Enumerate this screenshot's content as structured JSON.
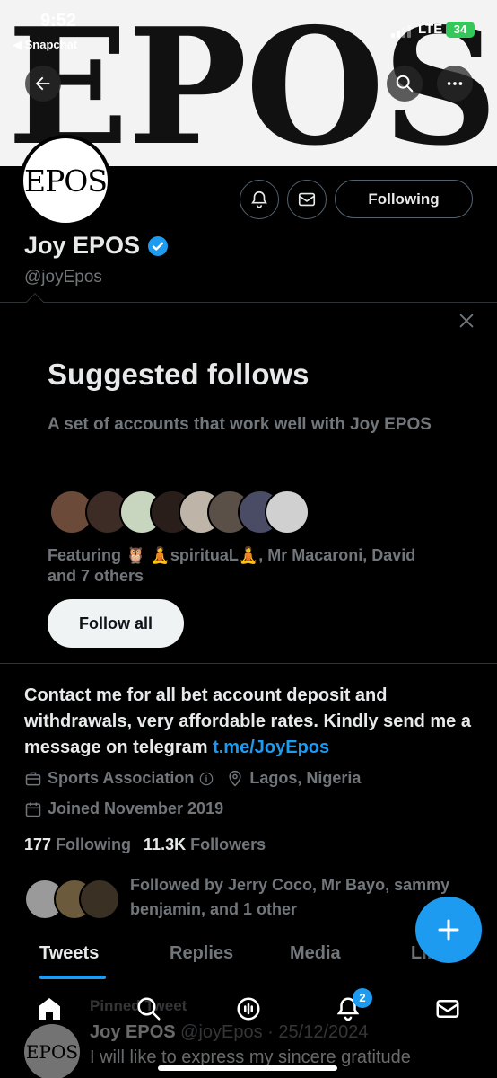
{
  "status_bar": {
    "time": "9:52",
    "back_app": "◀ Snapchat",
    "network": "LTE",
    "battery": "34"
  },
  "banner": {
    "text": "EPOS"
  },
  "profile": {
    "avatar_text": "EPOS",
    "display_name": "Joy EPOS",
    "handle": "@joyEpos",
    "following_button": "Following"
  },
  "suggested": {
    "title": "Suggested follows",
    "subtitle": "A set of accounts that work well with Joy EPOS",
    "featuring": "Featuring 🦉 🧘spirituaL🧘, Mr Macaroni, David and 7 others",
    "follow_all": "Follow all"
  },
  "bio": {
    "text": "Contact me for all bet account deposit and withdrawals, very affordable rates. Kindly send me a message on telegram ",
    "link": "t.me/JoyEpos"
  },
  "meta": {
    "category": "Sports Association",
    "location": "Lagos, Nigeria",
    "joined": "Joined November 2019"
  },
  "counts": {
    "following_count": "177",
    "following_label": "Following",
    "followers_count": "11.3K",
    "followers_label": "Followers"
  },
  "followed_by": "Followed by Jerry Coco, Mr Bayo, sammy benjamin, and 1 other",
  "tabs": [
    "Tweets",
    "Replies",
    "Media",
    "Likes"
  ],
  "tweet": {
    "pinned": "Pinned Tweet",
    "author": "Joy EPOS",
    "meta": "@joyEpos · 25/12/2024",
    "text": "I will like to express my sincere gratitude"
  },
  "nav": {
    "notifications_badge": "2"
  },
  "colors": {
    "accent": "#1d9bf0",
    "muted": "#71767b",
    "text": "#e7e9ea",
    "border": "#2f3336"
  }
}
